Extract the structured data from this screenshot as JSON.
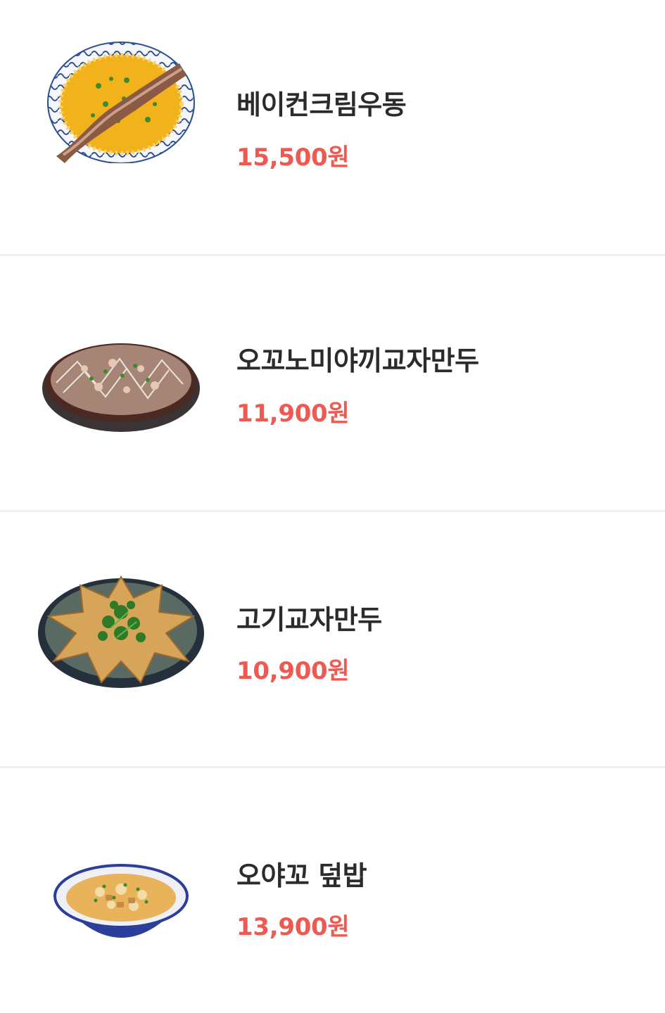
{
  "menu": {
    "accent_color": "#ee5a52",
    "items": [
      {
        "name": "베이컨크림우동",
        "price": "15,500원",
        "image_icon": "bacon-cream-udon-photo"
      },
      {
        "name": "오꼬노미야끼교자만두",
        "price": "11,900원",
        "image_icon": "okonomiyaki-gyoza-photo"
      },
      {
        "name": "고기교자만두",
        "price": "10,900원",
        "image_icon": "meat-gyoza-photo"
      },
      {
        "name": "오야꼬 덮밥",
        "price": "13,900원",
        "image_icon": "oyako-donburi-photo"
      }
    ]
  }
}
